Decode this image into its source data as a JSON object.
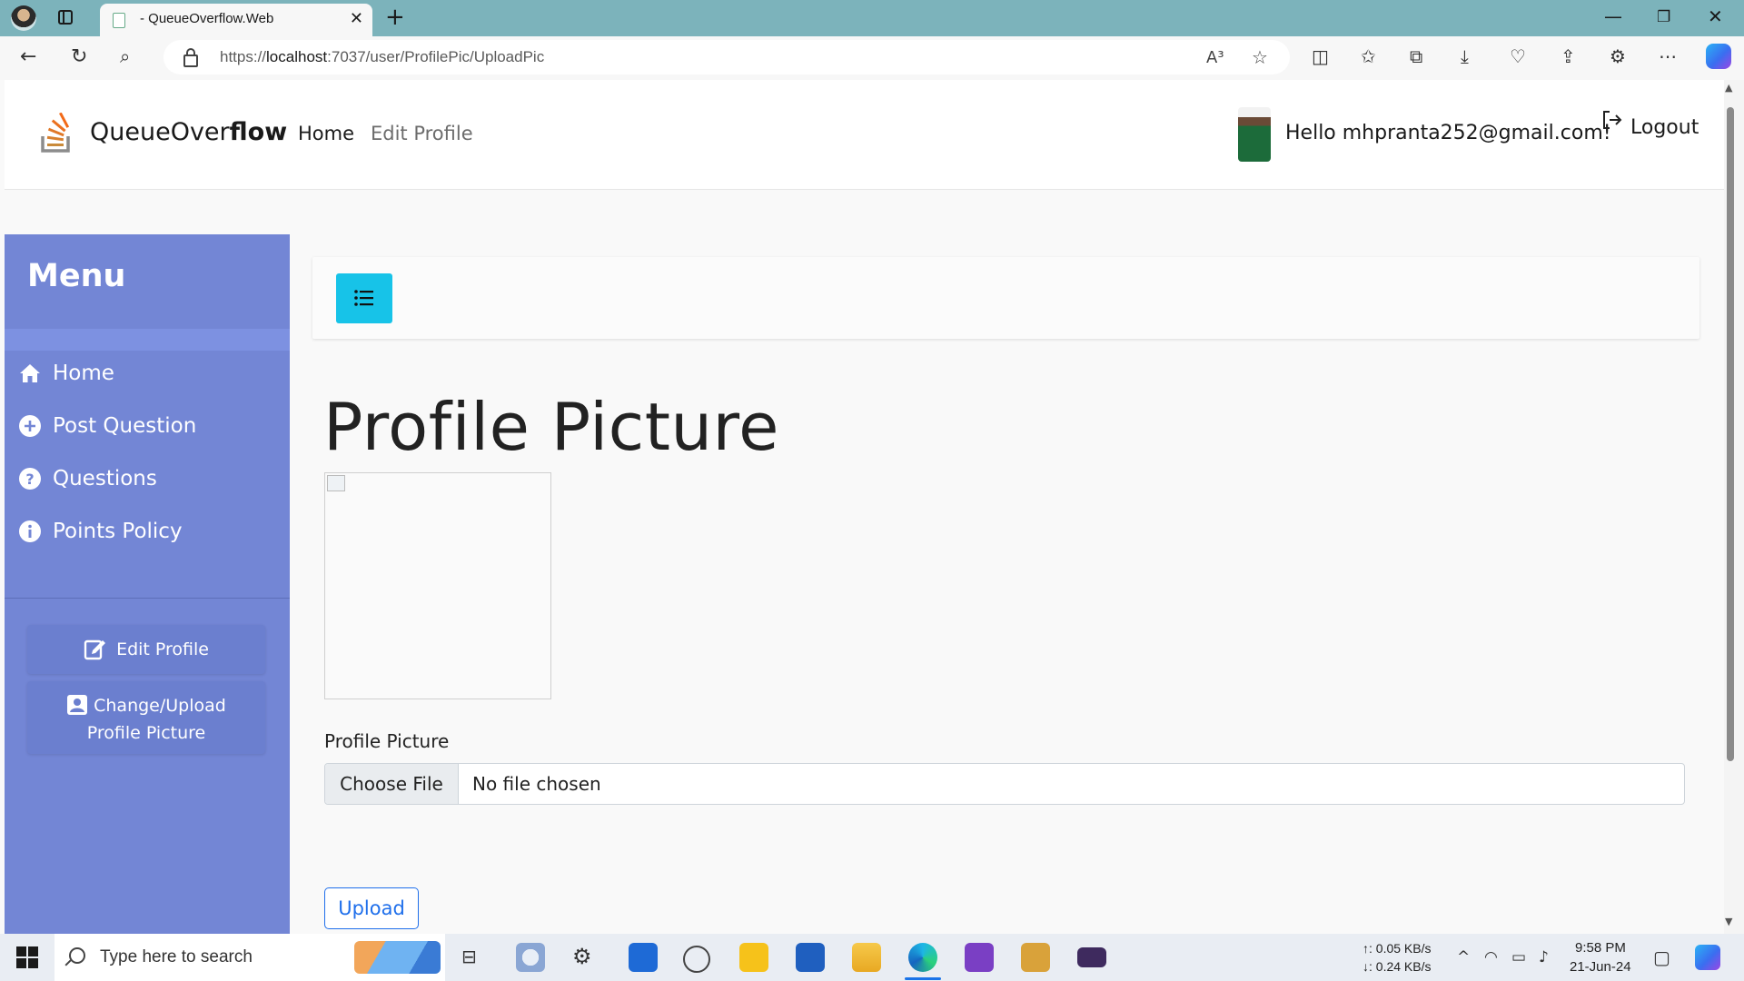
{
  "browser": {
    "tab_title": "- QueueOverflow.Web",
    "url_prefix": "https://",
    "url_host": "localhost",
    "url_path": ":7037/user/ProfilePic/UploadPic",
    "read_aloud_glyph": "A³"
  },
  "header": {
    "brand_light": "QueueOver",
    "brand_bold": "flow",
    "nav": {
      "home": "Home",
      "edit_profile": "Edit Profile"
    },
    "greeting": "Hello mhpranta252@gmail.com!",
    "logout": "Logout"
  },
  "sidebar": {
    "title": "Menu",
    "items": [
      {
        "label": "Home",
        "icon": "home-icon"
      },
      {
        "label": "Post Question",
        "icon": "plus-circle-icon"
      },
      {
        "label": "Questions",
        "icon": "question-circle-icon"
      },
      {
        "label": "Points Policy",
        "icon": "info-circle-icon"
      }
    ],
    "buttons": {
      "edit_profile": "Edit Profile",
      "change_pic_line1": "Change/Upload",
      "change_pic_line2": "Profile Picture"
    }
  },
  "main": {
    "title": "Profile Picture",
    "field_label": "Profile Picture",
    "choose_file": "Choose File",
    "file_status": "No file chosen",
    "upload": "Upload"
  },
  "taskbar": {
    "search_placeholder": "Type here to search",
    "upload_speed": "↑: 0.05 KB/s",
    "download_speed": "↓: 0.24 KB/s",
    "time": "9:58 PM",
    "date": "21-Jun-24"
  },
  "colors": {
    "sidebar": "#7386d5",
    "toggle_button": "#17c3e8",
    "upload_button": "#1f6feb",
    "titlebar": "#7cb3bb"
  }
}
